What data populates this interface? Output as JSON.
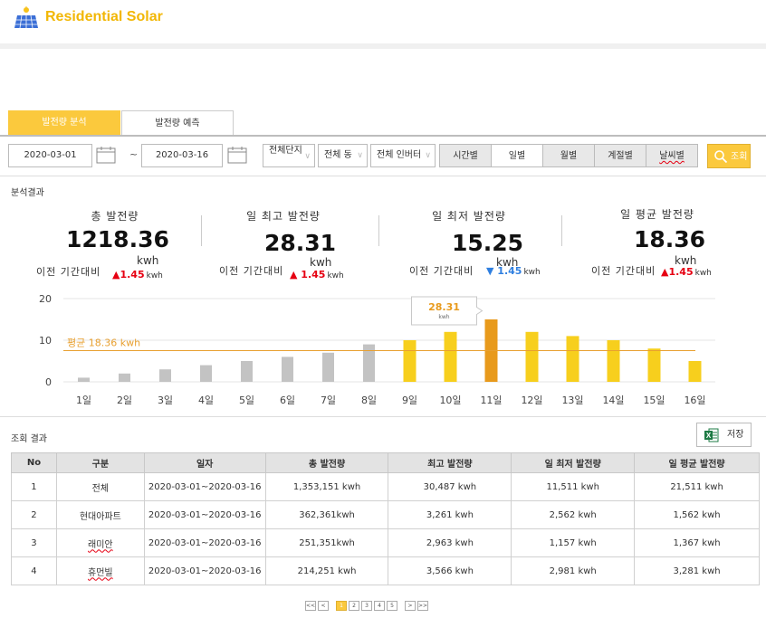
{
  "app": {
    "title": "Residential Solar"
  },
  "tabs": [
    {
      "label": "발전량 분석",
      "active": true
    },
    {
      "label": "발전량 예측",
      "active": false
    }
  ],
  "filters": {
    "start_date": "2020-03-01",
    "end_date": "2020-03-16",
    "range_separator": "~",
    "complex_select": "전체단지",
    "building_select": "전체 동",
    "inverter_select": "전체 인버터",
    "periods": [
      "시간별",
      "일별",
      "월별",
      "계절별",
      "날씨별"
    ],
    "search_label": "조회"
  },
  "analysis": {
    "section_title": "분석결과",
    "compare_label": "이전 기간대비",
    "kpis": [
      {
        "label": "총 발전량",
        "value": "1218.36",
        "unit": "kwh",
        "delta": "1.45",
        "delta_unit": "kwh",
        "direction": "up"
      },
      {
        "label": "일 최고 발전량",
        "value": "28.31",
        "unit": "kwh",
        "delta": "1.45",
        "delta_unit": "kwh",
        "direction": "up"
      },
      {
        "label": "일 최저 발전량",
        "value": "15.25",
        "unit": "kwh",
        "delta": "1.45",
        "delta_unit": "kwh",
        "direction": "down"
      },
      {
        "label": "일 평균 발전량",
        "value": "18.36",
        "unit": "kwh",
        "delta": "1.45",
        "delta_unit": "kwh",
        "direction": "up"
      }
    ]
  },
  "chart_data": {
    "type": "bar",
    "categories": [
      "1일",
      "2일",
      "3일",
      "4일",
      "5일",
      "6일",
      "7일",
      "8일",
      "9일",
      "10일",
      "11일",
      "12일",
      "13일",
      "14일",
      "15일",
      "16일"
    ],
    "values": [
      1,
      2,
      3,
      4,
      5,
      6,
      7,
      9,
      10,
      12,
      15,
      12,
      11,
      10,
      8,
      5
    ],
    "ylim": [
      0,
      20
    ],
    "yticks": [
      "0",
      "10",
      "20"
    ],
    "average": {
      "value": 7.5,
      "label": "평균 18.36 kwh"
    },
    "tooltip": {
      "value": "28.31",
      "unit": "kwh",
      "category_index": 10
    },
    "grid": true,
    "colors": {
      "low": "#c3c3c3",
      "high": "#f7cf1d",
      "peak": "#e89a1c",
      "average_line": "#e8a030",
      "average_text": "#e8a030",
      "tooltip_text": "#e89a1c"
    },
    "highlight_from_index": 8
  },
  "results": {
    "section_title": "조회 결과",
    "save_label": "저장",
    "columns": [
      "No",
      "구분",
      "일자",
      "총 발전량",
      "최고 발전량",
      "일 최저 발전량",
      "일 평균 발전량"
    ],
    "rows": [
      [
        "1",
        "전체",
        "2020-03-01~2020-03-16",
        "1,353,151 kwh",
        "30,487 kwh",
        "11,511 kwh",
        "21,511 kwh"
      ],
      [
        "2",
        "현대아파트",
        "2020-03-01~2020-03-16",
        "362,361kwh",
        "3,261 kwh",
        "2,562 kwh",
        "1,562 kwh"
      ],
      [
        "3",
        "래미안",
        "2020-03-01~2020-03-16",
        "251,351kwh",
        "2,963 kwh",
        "1,157 kwh",
        "1,367 kwh"
      ],
      [
        "4",
        "휴먼빌",
        "2020-03-01~2020-03-16",
        "214,251 kwh",
        "3,566 kwh",
        "2,981 kwh",
        "3,281 kwh"
      ]
    ]
  },
  "pagination": {
    "first": "<<",
    "prev": "<",
    "pages": [
      "1",
      "2",
      "3",
      "4",
      "5"
    ],
    "current": "1",
    "next": ">",
    "last": ">>"
  },
  "colors": {
    "accent": "#fbc93d",
    "brand_text": "#f2b705",
    "up": "#e60012",
    "down": "#2f7fe0"
  }
}
